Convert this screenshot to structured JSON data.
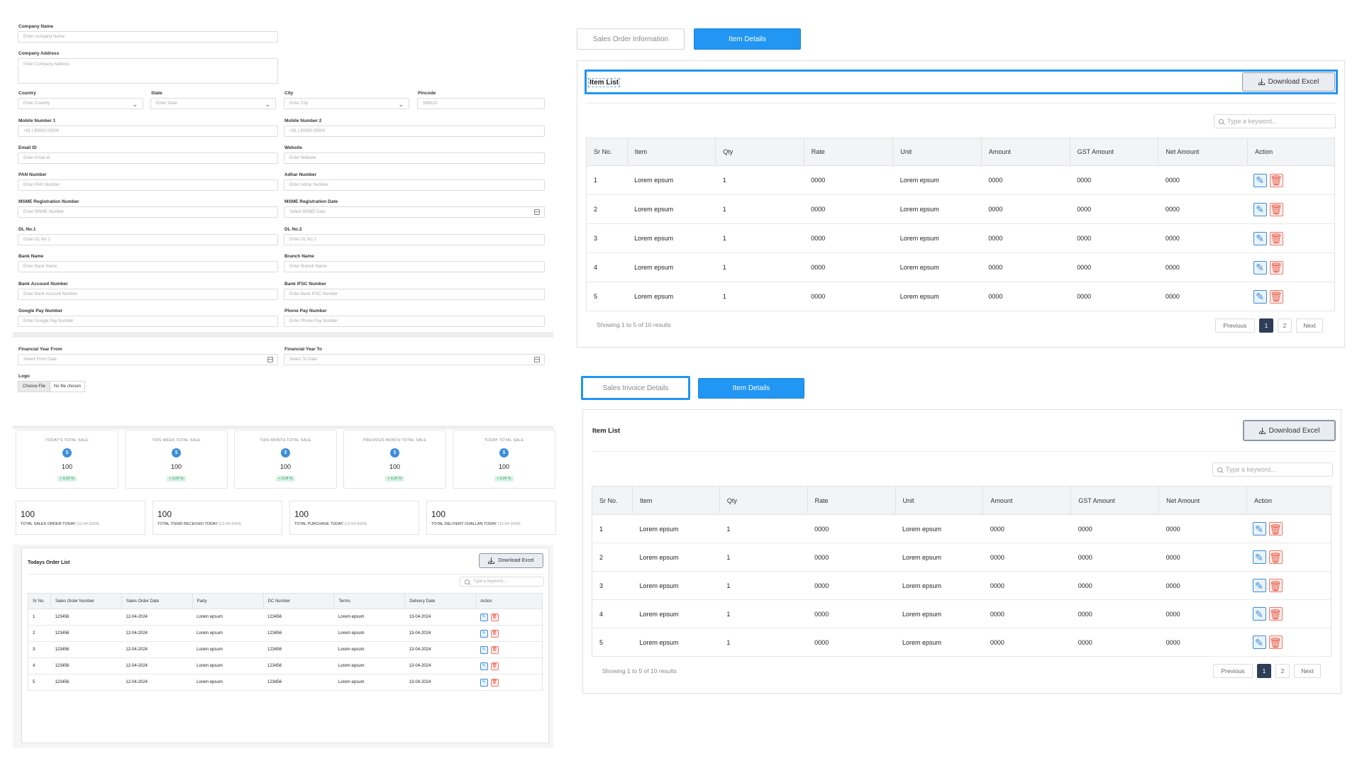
{
  "form": {
    "company_name": {
      "label": "Company Name",
      "placeholder": "Enter company Name"
    },
    "company_address": {
      "label": "Company Address",
      "placeholder": "Enter Company Address"
    },
    "country": {
      "label": "Country",
      "placeholder": "Enter Country"
    },
    "state": {
      "label": "State",
      "placeholder": "Enter State"
    },
    "city": {
      "label": "City",
      "placeholder": "Enter City"
    },
    "pincode": {
      "label": "Pincode",
      "placeholder": "998523"
    },
    "mobile1": {
      "label": "Mobile Number 1",
      "placeholder": "+91  |  90000 00000"
    },
    "mobile2": {
      "label": "Mobile Number 2",
      "placeholder": "+91  |  90000 00000"
    },
    "email": {
      "label": "Email ID",
      "placeholder": "Enter Email id"
    },
    "website": {
      "label": "Website",
      "placeholder": "Enter Website"
    },
    "pan": {
      "label": "PAN Number",
      "placeholder": "Enter PAN Number"
    },
    "adhar": {
      "label": "Adhar Number",
      "placeholder": "Enter Adhar Number"
    },
    "msme_no": {
      "label": "MSME Registration Number",
      "placeholder": "Enter MSME Number"
    },
    "msme_date": {
      "label": "MSME Registration Date",
      "placeholder": "Select MSME Date"
    },
    "dl1": {
      "label": "DL No.1",
      "placeholder": "Enter DL No 1"
    },
    "dl2": {
      "label": "DL No.2",
      "placeholder": "Enter DL No 2"
    },
    "bank_name": {
      "label": "Bank Name",
      "placeholder": "Enter Bank Name"
    },
    "branch": {
      "label": "Branch Name",
      "placeholder": "Enter Branch Name"
    },
    "account": {
      "label": "Bank Account Number",
      "placeholder": "Enter Bank Account Number"
    },
    "ifsc": {
      "label": "Bank IFSC Number",
      "placeholder": "Enter Bank IFSC Number"
    },
    "gpay": {
      "label": "Google Pay Number",
      "placeholder": "Enter Google Pay Number"
    },
    "phonepe": {
      "label": "Phone Pay Number",
      "placeholder": "Enter Phone Pay Number"
    },
    "fy_from": {
      "label": "Financial Year From",
      "placeholder": "Select From Date"
    },
    "fy_to": {
      "label": "Financial Year To",
      "placeholder": "Select To Date"
    },
    "logo": {
      "label": "Logo",
      "button": "Choose File",
      "status": "No file chosen"
    }
  },
  "stats": [
    {
      "title": "TODAY'S TOTAL SALE",
      "value": "100",
      "badge": "+ 0.24 %"
    },
    {
      "title": "THIS WEEK TOTAL SALE",
      "value": "100",
      "badge": "+ 0.24 %"
    },
    {
      "title": "THIS MONTH TOTAL SALE",
      "value": "100",
      "badge": "+ 0.24 %"
    },
    {
      "title": "PREVIOUS MONTH TOTAL SALE",
      "value": "100",
      "badge": "+ 0.24 %"
    },
    {
      "title": "TODAY TOTAL SALE",
      "value": "100",
      "badge": "+ 0.24 %"
    }
  ],
  "totals": [
    {
      "value": "100",
      "label": "TOTAL SALES ORDER TODAY",
      "date": "(12-04-2024)"
    },
    {
      "value": "100",
      "label": "TOTAL ITEMS RECEIVED TODAY",
      "date": "(12-04-2024)"
    },
    {
      "value": "100",
      "label": "TOTAL PURCHASE TODAY",
      "date": "(12-04-2024)"
    },
    {
      "value": "100",
      "label": "TOTAL DELIVERY CHALLAN TODAY",
      "date": "(12-04-2024)"
    }
  ],
  "orders": {
    "title": "Todays Order List",
    "download_label": "Download Excel",
    "search_placeholder": "Type a keyword...",
    "columns": [
      "Sr No.",
      "Sales Order Number",
      "Sales Order Date",
      "Party",
      "DC Number",
      "Terms",
      "Delivery Date",
      "Action"
    ],
    "rows": [
      [
        "1",
        "123456",
        "12-04-2024",
        "Lorem epsum",
        "123456",
        "Lorem epsum",
        "13-04-2024"
      ],
      [
        "2",
        "123456",
        "12-04-2024",
        "Lorem epsum",
        "123456",
        "Lorem epsum",
        "13-04-2024"
      ],
      [
        "3",
        "123456",
        "12-04-2024",
        "Lorem epsum",
        "123456",
        "Lorem epsum",
        "13-04-2024"
      ],
      [
        "4",
        "123456",
        "12-04-2024",
        "Lorem epsum",
        "123456",
        "Lorem epsum",
        "13-04-2024"
      ],
      [
        "5",
        "123456",
        "12-04-2024",
        "Lorem epsum",
        "123456",
        "Lorem epsum",
        "13-04-2024"
      ]
    ]
  },
  "sales_order": {
    "tabs": [
      "Sales Order Information",
      "Item Details"
    ],
    "title": "Item List",
    "download_label": "Download Excel",
    "search_placeholder": "Type a keyword...",
    "columns": [
      "Sr No.",
      "Item",
      "Qty",
      "Rate",
      "Unit",
      "Amount",
      "GST Amount",
      "Net Amount",
      "Action"
    ],
    "rows": [
      [
        "1",
        "Lorem epsum",
        "1",
        "0000",
        "Lorem epsum",
        "0000",
        "0000",
        "0000"
      ],
      [
        "2",
        "Lorem epsum",
        "1",
        "0000",
        "Lorem epsum",
        "0000",
        "0000",
        "0000"
      ],
      [
        "3",
        "Lorem epsum",
        "1",
        "0000",
        "Lorem epsum",
        "0000",
        "0000",
        "0000"
      ],
      [
        "4",
        "Lorem epsum",
        "1",
        "0000",
        "Lorem epsum",
        "0000",
        "0000",
        "0000"
      ],
      [
        "5",
        "Lorem epsum",
        "1",
        "0000",
        "Lorem epsum",
        "0000",
        "0000",
        "0000"
      ]
    ],
    "showing": "Showing 1 to 5 of 10 results",
    "pagination": {
      "previous": "Previous",
      "pages": [
        "1",
        "2"
      ],
      "next": "Next"
    }
  },
  "sales_invoice": {
    "tabs": [
      "Sales Invoice Details",
      "Item Details"
    ],
    "title": "Item List",
    "download_label": "Download Excel",
    "search_placeholder": "Type a keyword...",
    "columns": [
      "Sr No.",
      "Item",
      "Qty",
      "Rate",
      "Unit",
      "Amount",
      "GST Amount",
      "Net Amount",
      "Action"
    ],
    "rows": [
      [
        "1",
        "Lorem epsum",
        "1",
        "0000",
        "Lorem epsum",
        "0000",
        "0000",
        "0000"
      ],
      [
        "2",
        "Lorem epsum",
        "1",
        "0000",
        "Lorem epsum",
        "0000",
        "0000",
        "0000"
      ],
      [
        "3",
        "Lorem epsum",
        "1",
        "0000",
        "Lorem epsum",
        "0000",
        "0000",
        "0000"
      ],
      [
        "4",
        "Lorem epsum",
        "1",
        "0000",
        "Lorem epsum",
        "0000",
        "0000",
        "0000"
      ],
      [
        "5",
        "Lorem epsum",
        "1",
        "0000",
        "Lorem epsum",
        "0000",
        "0000",
        "0000"
      ]
    ],
    "showing": "Showing 1 to 5 of 10 results",
    "pagination": {
      "previous": "Previous",
      "pages": [
        "1",
        "2"
      ],
      "next": "Next"
    }
  },
  "colors": {
    "accent": "#2196f3",
    "stat_icon": "#3b8ed8",
    "badge_bg": "#d9f2e6",
    "badge_text": "#2a9a63",
    "page_active": "#2f3e57",
    "edit": "#3b8ed8",
    "delete": "#e65a48"
  },
  "icons": {
    "edit": "edit-icon",
    "delete": "trash-icon",
    "download": "download-icon",
    "search": "search-icon",
    "calendar": "calendar-icon",
    "dropdown": "chevron-down-icon",
    "stat": "currency-icon"
  }
}
